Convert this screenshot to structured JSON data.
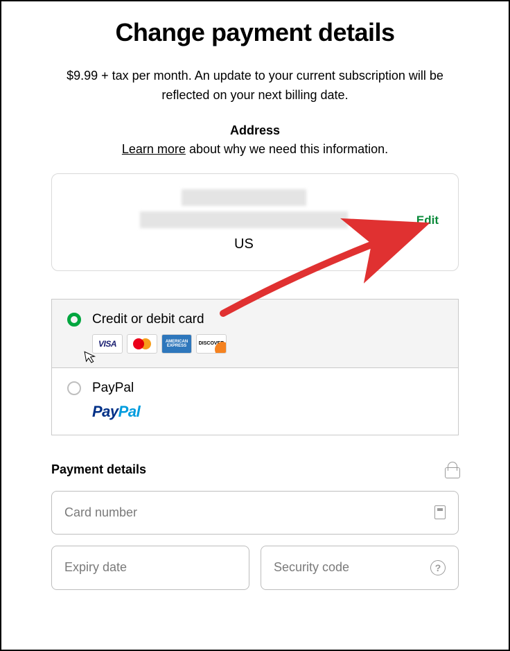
{
  "title": "Change payment details",
  "subtitle": "$9.99 + tax per month. An update to your current subscription will be reflected on your next billing date.",
  "address": {
    "heading": "Address",
    "learn_more": "Learn more",
    "learn_more_tail": " about why we need this information.",
    "country": "US",
    "edit": "Edit"
  },
  "methods": {
    "card_label": "Credit or debit card",
    "paypal_label": "PayPal",
    "logos": {
      "visa": "VISA",
      "amex": "AMERICAN EXPRESS",
      "discover": "DISCOVER"
    }
  },
  "details": {
    "heading": "Payment details",
    "card_number_placeholder": "Card number",
    "expiry_placeholder": "Expiry date",
    "cvc_placeholder": "Security code",
    "help_glyph": "?"
  }
}
